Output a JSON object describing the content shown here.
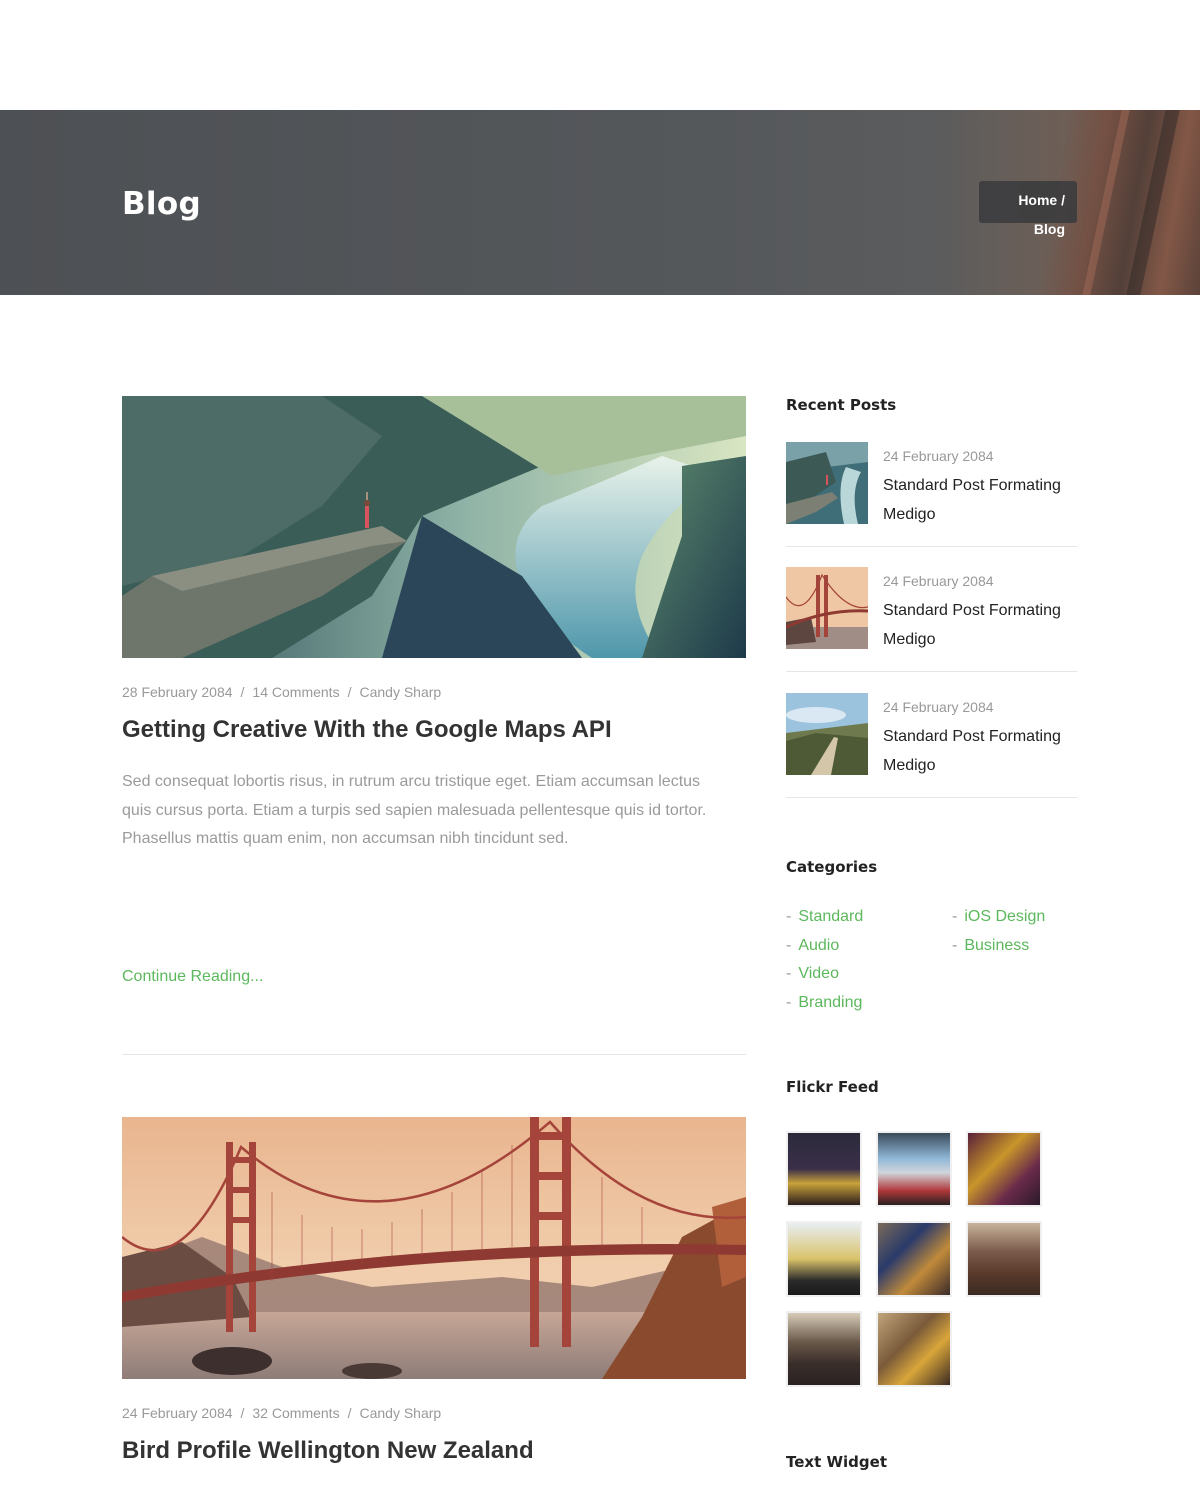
{
  "banner": {
    "title": "Blog",
    "breadcrumb_home": "Home /",
    "breadcrumb_current": "Blog"
  },
  "posts": [
    {
      "date": "28 February 2084",
      "comments": "14 Comments",
      "author": "Candy Sharp",
      "title": "Getting Creative With the Google Maps API",
      "excerpt": "Sed consequat lobortis risus, in rutrum arcu tristique eget. Etiam accumsan lectus quis cursus porta. Etiam a turpis sed sapien malesuada pellentesque quis id tortor. Phasellus mattis quam enim, non accumsan nibh tincidunt sed.",
      "continue_label": "Continue Reading...",
      "image": "fjord-yoga-photo"
    },
    {
      "date": "24 February 2084",
      "comments": "32 Comments",
      "author": "Candy Sharp",
      "title": "Bird Profile Wellington New Zealand",
      "image": "golden-gate-bridge-photo"
    }
  ],
  "meta_separator": "/",
  "sidebar": {
    "recent_posts": {
      "title": "Recent Posts",
      "items": [
        {
          "date": "24 February 2084",
          "title": "Standard Post Formating Medigo",
          "thumb": "fjord-thumb"
        },
        {
          "date": "24 February 2084",
          "title": "Standard Post Formating Medigo",
          "thumb": "bridge-thumb"
        },
        {
          "date": "24 February 2084",
          "title": "Standard Post Formating Medigo",
          "thumb": "road-thumb"
        }
      ]
    },
    "categories": {
      "title": "Categories",
      "left": [
        "Standard",
        "Audio",
        "Video",
        "Branding"
      ],
      "right": [
        "iOS Design",
        "Business"
      ],
      "dash": "-"
    },
    "flickr": {
      "title": "Flickr Feed",
      "count": 8
    },
    "text_widget": {
      "title": "Text Widget"
    }
  },
  "colors": {
    "accent": "#5cb85c",
    "meta": "#999999",
    "heading": "#333333"
  }
}
